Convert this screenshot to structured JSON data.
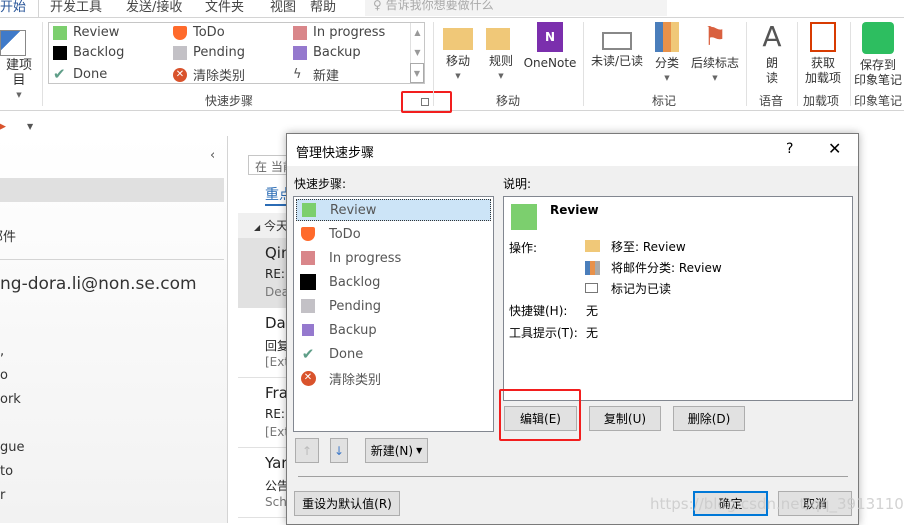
{
  "tabs": {
    "active": "开始",
    "items": [
      "开发工具",
      "发送/接收",
      "文件夹",
      "视图",
      "帮助"
    ],
    "search_placeholder": "告诉我你想要做什么"
  },
  "ribbon": {
    "new_item": "建项目",
    "quick_steps": {
      "items": [
        {
          "label": "Review",
          "icon": "green-square",
          "color": "#7ccf6e"
        },
        {
          "label": "ToDo",
          "icon": "orange-shield",
          "color": "#ff6a2b"
        },
        {
          "label": "In progress",
          "icon": "pink-square",
          "color": "#d9868a"
        },
        {
          "label": "Backlog",
          "icon": "black-square",
          "color": "#000000"
        },
        {
          "label": "Pending",
          "icon": "gray-square",
          "color": "#c3c1c6"
        },
        {
          "label": "Backup",
          "icon": "purple-square",
          "color": "#9579ce"
        },
        {
          "label": "Done",
          "icon": "check-icon",
          "color": "#5f9e88"
        },
        {
          "label": "清除类别",
          "icon": "clear-x-icon",
          "color": "#d9532c"
        },
        {
          "label": "新建",
          "icon": "new-spark-icon",
          "color": "#555555"
        }
      ],
      "group_label": "快速步骤"
    },
    "move": {
      "buttons": [
        "移动",
        "规则",
        "OneNote"
      ],
      "group_label": "移动"
    },
    "tags": {
      "buttons": [
        "未读/已读",
        "分类",
        "后续标志"
      ],
      "group_label": "标记"
    },
    "speech": {
      "button": [
        "朗",
        "读"
      ],
      "group_label": "语音"
    },
    "addins": {
      "button": [
        "获取",
        "加载项"
      ],
      "group_label": "加载项"
    },
    "evernote": {
      "button": [
        "保存到",
        "印象笔记"
      ],
      "group_label": "印象笔记"
    }
  },
  "nav": {
    "item1": "邮件",
    "account": "ng-dora.li@non.se.com",
    "folders": [
      ",",
      "o",
      "ork",
      "",
      "gue",
      "to",
      "r"
    ]
  },
  "maillist": {
    "search": "在 当前",
    "focused": "重点",
    "group": "今天",
    "items": [
      {
        "from": "Qin",
        "subject": "RE:",
        "preview": "Dea"
      },
      {
        "from": "Dar",
        "subject": "回复",
        "preview": "[Ext"
      },
      {
        "from": "Fra",
        "subject": "RE:",
        "preview": "[Ext"
      },
      {
        "from": "Yar",
        "subject": "公告",
        "preview": "Sch"
      }
    ]
  },
  "dialog": {
    "title": "管理快速步骤",
    "help": "?",
    "list_label": "快速步骤:",
    "desc_label": "说明:",
    "selected": "Review",
    "actions_label": "操作:",
    "actions": [
      "移至: Review",
      "将邮件分类: Review",
      "标记为已读"
    ],
    "shortcut_label": "快捷键(H):",
    "shortcut_value": "无",
    "tooltip_label": "工具提示(T):",
    "tooltip_value": "无",
    "edit": "编辑(E)",
    "copy": "复制(U)",
    "delete": "删除(D)",
    "new": "新建(N)",
    "reset": "重设为默认值(R)",
    "ok": "确定",
    "cancel": "取消"
  },
  "watermark": "https://blog.csdn.net/qq_39131100",
  "colors": {
    "accent": "#0078d7",
    "highlight": "#f21e1e"
  }
}
